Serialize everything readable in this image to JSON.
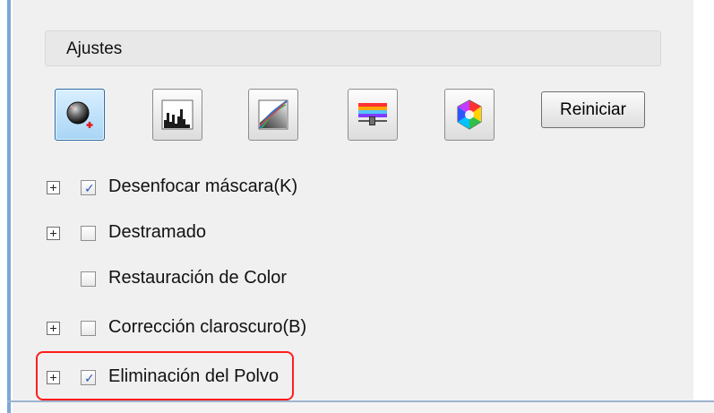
{
  "settings_group": {
    "title": "Ajustes"
  },
  "toolbar": {
    "tools": [
      {
        "icon": "auto-exposure-icon",
        "active": true
      },
      {
        "icon": "histogram-icon",
        "active": false
      },
      {
        "icon": "tone-curve-icon",
        "active": false
      },
      {
        "icon": "image-adjustment-icon",
        "active": false
      },
      {
        "icon": "color-palette-icon",
        "active": false
      }
    ],
    "reset_label": "Reiniciar"
  },
  "options": [
    {
      "label": "Desenfocar máscara(K)",
      "checked": true,
      "expandable": true
    },
    {
      "label": "Destramado",
      "checked": false,
      "expandable": true
    },
    {
      "label": "Restauración de Color",
      "checked": false,
      "expandable": false
    },
    {
      "label": "Corrección claroscuro(B)",
      "checked": false,
      "expandable": true
    },
    {
      "label": "Eliminación del Polvo",
      "checked": true,
      "expandable": true
    }
  ],
  "highlight_color": "#ff1c1c"
}
